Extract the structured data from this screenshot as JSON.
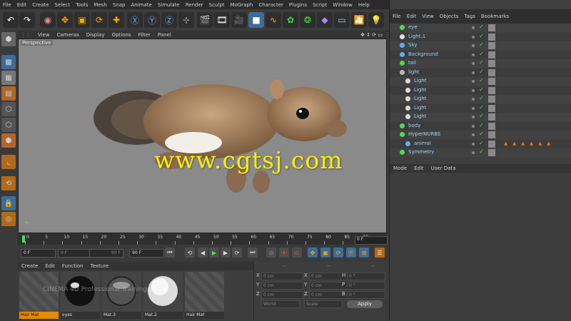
{
  "menubar": [
    "File",
    "Edit",
    "Create",
    "Select",
    "Tools",
    "Mesh",
    "Snap",
    "Animate",
    "Simulate",
    "Render",
    "Sculpt",
    "MoGraph",
    "Character",
    "Plugins",
    "Script",
    "Window",
    "Help"
  ],
  "viewport_menu": [
    "View",
    "Cameras",
    "Display",
    "Options",
    "Filter",
    "Panel"
  ],
  "viewport_label": "Perspective",
  "watermark": "www.cgtsj.com",
  "timeline": {
    "ticks": [
      "0",
      "5",
      "10",
      "15",
      "20",
      "25",
      "30",
      "35",
      "40",
      "45",
      "50",
      "55",
      "60",
      "65",
      "70",
      "75",
      "80",
      "85",
      "90"
    ],
    "current_frame": "0 F",
    "start": "0 F",
    "min": "0 F",
    "max": "90 F",
    "end": "90 F"
  },
  "material_menu": [
    "Create",
    "Edit",
    "Function",
    "Texture"
  ],
  "materials": [
    {
      "name": "Hair Mat"
    },
    {
      "name": "eyes"
    },
    {
      "name": "Mat.3"
    },
    {
      "name": "Mat.2"
    },
    {
      "name": "Hair Mat"
    }
  ],
  "material_watermark": "CINEMA 4D  Professional Training",
  "coords": {
    "col_headers": [
      "--",
      "--",
      "--"
    ],
    "rows": [
      {
        "a": "X",
        "v1": "0 cm",
        "b": "X",
        "v2": "0 cm",
        "c": "H",
        "v3": "0 °"
      },
      {
        "a": "Y",
        "v1": "0 cm",
        "b": "Y",
        "v2": "0 cm",
        "c": "P",
        "v3": "0 °"
      },
      {
        "a": "Z",
        "v1": "0 cm",
        "b": "Z",
        "v2": "0 cm",
        "c": "B",
        "v3": "0 °"
      }
    ],
    "world": "World",
    "scale": "Scale",
    "apply": "Apply"
  },
  "object_manager": {
    "menu": [
      "File",
      "Edit",
      "View",
      "Objects",
      "Tags",
      "Bookmarks"
    ],
    "objects": [
      {
        "name": "eye",
        "indent": 1,
        "color": "#4fdc4f"
      },
      {
        "name": "Light.1",
        "indent": 1,
        "color": "#dddddd"
      },
      {
        "name": "Sky",
        "indent": 1,
        "color": "#66aaff"
      },
      {
        "name": "Background",
        "indent": 1,
        "color": "#66aaff"
      },
      {
        "name": "tail",
        "indent": 1,
        "color": "#4fdc4f"
      },
      {
        "name": "light",
        "indent": 1,
        "color": "#bbbbbb"
      },
      {
        "name": "Light",
        "indent": 2,
        "color": "#dddddd"
      },
      {
        "name": "Light",
        "indent": 2,
        "color": "#dddddd"
      },
      {
        "name": "Light",
        "indent": 2,
        "color": "#dddddd"
      },
      {
        "name": "Light",
        "indent": 2,
        "color": "#dddddd"
      },
      {
        "name": "Light",
        "indent": 2,
        "color": "#dddddd"
      },
      {
        "name": "body",
        "indent": 1,
        "color": "#4fdc4f"
      },
      {
        "name": "HyperNURBS",
        "indent": 1,
        "color": "#4fdc4f"
      },
      {
        "name": "animal",
        "indent": 2,
        "color": "#66aaff"
      },
      {
        "name": "Symmetry",
        "indent": 1,
        "color": "#4fdc4f"
      }
    ]
  },
  "attribute_manager": {
    "menu": [
      "Mode",
      "Edit",
      "User Data"
    ]
  }
}
